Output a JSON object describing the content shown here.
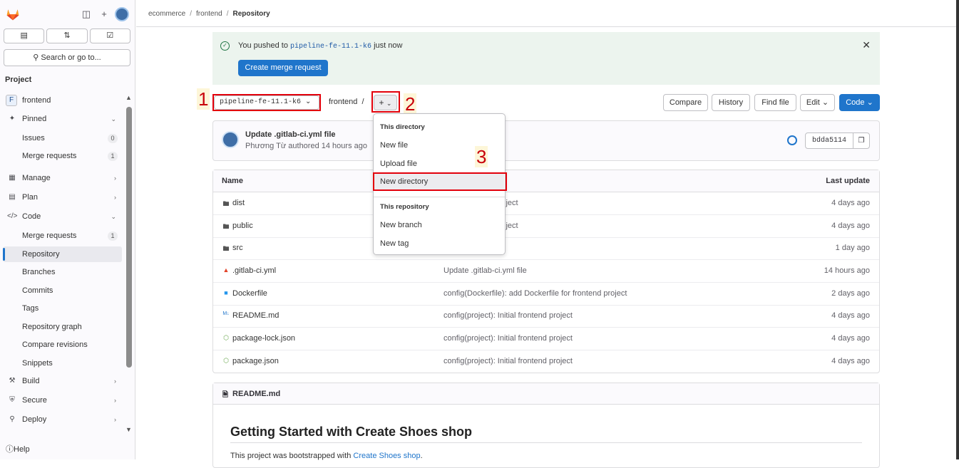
{
  "sidebar": {
    "project_heading": "Project",
    "project_initial": "F",
    "search_label": "Search or go to...",
    "help": "Help",
    "items": {
      "frontend": "frontend",
      "pinned": "Pinned",
      "issues": "Issues",
      "issues_count": "0",
      "mr_pinned": "Merge requests",
      "mr_pinned_count": "1",
      "manage": "Manage",
      "plan": "Plan",
      "code": "Code",
      "mr_code": "Merge requests",
      "mr_code_count": "1",
      "repository": "Repository",
      "branches": "Branches",
      "commits": "Commits",
      "tags": "Tags",
      "repo_graph": "Repository graph",
      "compare_revisions": "Compare revisions",
      "snippets": "Snippets",
      "build": "Build",
      "secure": "Secure",
      "deploy": "Deploy"
    }
  },
  "breadcrumb": {
    "a": "ecommerce",
    "b": "frontend",
    "c": "Repository"
  },
  "alert": {
    "pre": "You pushed to ",
    "branch": "pipeline-fe-11.1-k6",
    "post": " just now",
    "button": "Create merge request"
  },
  "toolbar": {
    "branch": "pipeline-fe-11.1-k6",
    "path": "frontend",
    "path_sep": "/",
    "plus": "+",
    "compare": "Compare",
    "history": "History",
    "find_file": "Find file",
    "edit": "Edit",
    "code": "Code"
  },
  "annotations": {
    "one": "1",
    "two": "2",
    "three": "3"
  },
  "commit": {
    "title": "Update .gitlab-ci.yml file",
    "author": "Phương Từ",
    "authored": " authored 14 hours ago",
    "sha": "bdda5114"
  },
  "table": {
    "col_name": "Name",
    "col_update": "Last update",
    "rows": [
      {
        "name": "dist",
        "commit": "initial frontend project",
        "date": "4 days ago"
      },
      {
        "name": "public",
        "commit": "initial frontend project",
        "date": "4 days ago"
      },
      {
        "name": "src",
        "commit": "",
        "date": "1 day ago"
      },
      {
        "name": ".gitlab-ci.yml",
        "commit": "Update .gitlab-ci.yml file",
        "date": "14 hours ago"
      },
      {
        "name": "Dockerfile",
        "commit": "config(Dockerfile): add Dockerfile for frontend project",
        "date": "2 days ago"
      },
      {
        "name": "README.md",
        "commit": "config(project): Initial frontend project",
        "date": "4 days ago"
      },
      {
        "name": "package-lock.json",
        "commit": "config(project): Initial frontend project",
        "date": "4 days ago"
      },
      {
        "name": "package.json",
        "commit": "config(project): Initial frontend project",
        "date": "4 days ago"
      }
    ]
  },
  "dropdown": {
    "this_directory": "This directory",
    "new_file": "New file",
    "upload_file": "Upload file",
    "new_directory": "New directory",
    "this_repository": "This repository",
    "new_branch": "New branch",
    "new_tag": "New tag"
  },
  "readme": {
    "file": "README.md",
    "heading": "Getting Started with Create Shoes shop",
    "text_pre": "This project was bootstrapped with ",
    "link": "Create Shoes shop",
    "text_post": "."
  },
  "colors": {
    "primary": "#1f75cb",
    "alert_bg": "#ecf4ee",
    "annotation": "#e3000b"
  },
  "icons": [
    "gitlab-logo",
    "sidebar-toggle-icon",
    "plus-icon",
    "avatar",
    "issues-icon",
    "merge-request-icon",
    "todo-icon",
    "search-icon",
    "pin-icon",
    "manage-icon",
    "plan-icon",
    "code-icon",
    "build-icon",
    "secure-icon",
    "deploy-icon",
    "help-icon",
    "check-circle-icon",
    "close-icon",
    "folder-icon",
    "gitlab-file-icon",
    "docker-icon",
    "markdown-icon",
    "node-icon",
    "pipeline-status-icon",
    "copy-icon"
  ]
}
